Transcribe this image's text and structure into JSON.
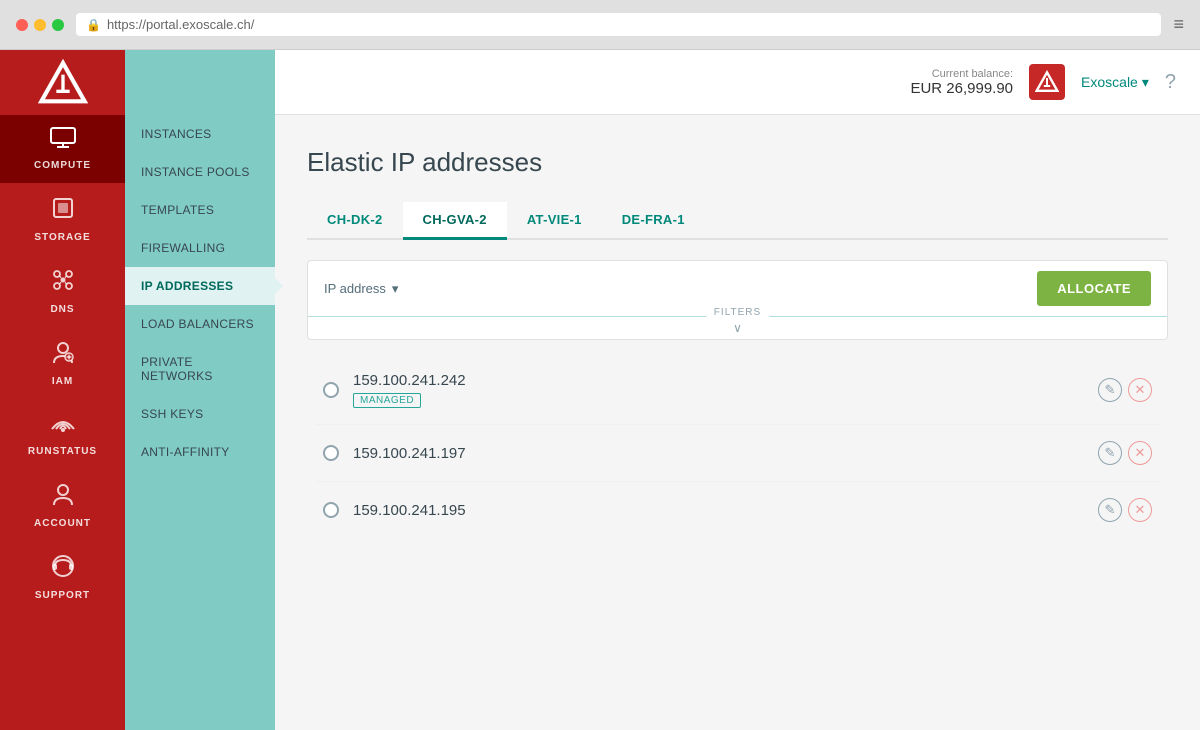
{
  "browser": {
    "url": "https://portal.exoscale.ch/"
  },
  "header": {
    "balance_label": "Current balance:",
    "balance_amount": "EUR 26,999.90",
    "account_name": "Exoscale",
    "help_label": "?"
  },
  "logo": {
    "alt": "Exoscale"
  },
  "icon_nav": {
    "items": [
      {
        "id": "compute",
        "label": "COMPUTE",
        "icon": "🖥",
        "active": true
      },
      {
        "id": "storage",
        "label": "STORAGE",
        "icon": "📦",
        "active": false
      },
      {
        "id": "dns",
        "label": "DNS",
        "icon": "🔗",
        "active": false
      },
      {
        "id": "iam",
        "label": "IAM",
        "icon": "👤",
        "active": false
      },
      {
        "id": "runstatus",
        "label": "RUNSTATUS",
        "icon": "📡",
        "active": false
      },
      {
        "id": "account",
        "label": "ACCOUNT",
        "icon": "👤",
        "active": false
      },
      {
        "id": "support",
        "label": "SUPPORT",
        "icon": "🎧",
        "active": false
      }
    ]
  },
  "sub_nav": {
    "items": [
      {
        "id": "instances",
        "label": "INSTANCES",
        "active": false
      },
      {
        "id": "instance-pools",
        "label": "INSTANCE POOLS",
        "active": false
      },
      {
        "id": "templates",
        "label": "TEMPLATES",
        "active": false
      },
      {
        "id": "firewalling",
        "label": "FIREWALLING",
        "active": false
      },
      {
        "id": "ip-addresses",
        "label": "IP ADDRESSES",
        "active": true
      },
      {
        "id": "load-balancers",
        "label": "LOAD BALANCERS",
        "active": false
      },
      {
        "id": "private-networks",
        "label": "PRIVATE NETWORKS",
        "active": false
      },
      {
        "id": "ssh-keys",
        "label": "SSH KEYS",
        "active": false
      },
      {
        "id": "anti-affinity",
        "label": "ANTI-AFFINITY",
        "active": false
      }
    ]
  },
  "page": {
    "title": "Elastic IP addresses",
    "tabs": [
      {
        "id": "ch-dk-2",
        "label": "CH-DK-2",
        "active": false
      },
      {
        "id": "ch-gva-2",
        "label": "CH-GVA-2",
        "active": true
      },
      {
        "id": "at-vie-1",
        "label": "AT-VIE-1",
        "active": false
      },
      {
        "id": "de-fra-1",
        "label": "DE-FRA-1",
        "active": false
      }
    ],
    "filter": {
      "dropdown_label": "IP address",
      "filters_label": "FILTERS",
      "allocate_label": "ALLOCATE"
    },
    "ip_addresses": [
      {
        "address": "159.100.241.242",
        "badge": "MANAGED",
        "has_badge": true
      },
      {
        "address": "159.100.241.197",
        "badge": "",
        "has_badge": false
      },
      {
        "address": "159.100.241.195",
        "badge": "",
        "has_badge": false
      }
    ]
  }
}
